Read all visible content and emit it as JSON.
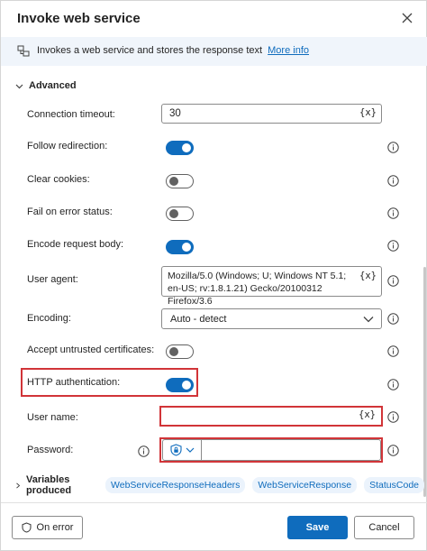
{
  "dialog": {
    "title": "Invoke web service",
    "info_text": "Invokes a web service and stores the response text",
    "info_link": "More info"
  },
  "advanced": {
    "label": "Advanced",
    "connection_timeout": {
      "label": "Connection timeout:",
      "value": "30"
    },
    "follow_redirection": {
      "label": "Follow redirection:",
      "state": "on"
    },
    "clear_cookies": {
      "label": "Clear cookies:",
      "state": "off"
    },
    "fail_on_error": {
      "label": "Fail on error status:",
      "state": "off"
    },
    "encode_body": {
      "label": "Encode request body:",
      "state": "on"
    },
    "user_agent": {
      "label": "User agent:",
      "value": "Mozilla/5.0 (Windows; U; Windows NT 5.1; en-US; rv:1.8.1.21) Gecko/20100312 Firefox/3.6"
    },
    "encoding": {
      "label": "Encoding:",
      "value": "Auto - detect"
    },
    "accept_certs": {
      "label": "Accept untrusted certificates:",
      "state": "off"
    },
    "http_auth": {
      "label": "HTTP authentication:",
      "state": "on"
    },
    "user_name": {
      "label": "User name:",
      "value": ""
    },
    "password": {
      "label": "Password:",
      "value": ""
    }
  },
  "var_button": "{x}",
  "variables": {
    "label": "Variables produced",
    "chips": [
      "WebServiceResponseHeaders",
      "WebServiceResponse",
      "StatusCode"
    ]
  },
  "footer": {
    "on_error": "On error",
    "save": "Save",
    "cancel": "Cancel"
  },
  "colors": {
    "accent": "#0f6cbd",
    "highlight": "#d13438",
    "info_bg": "#f0f5fb"
  }
}
